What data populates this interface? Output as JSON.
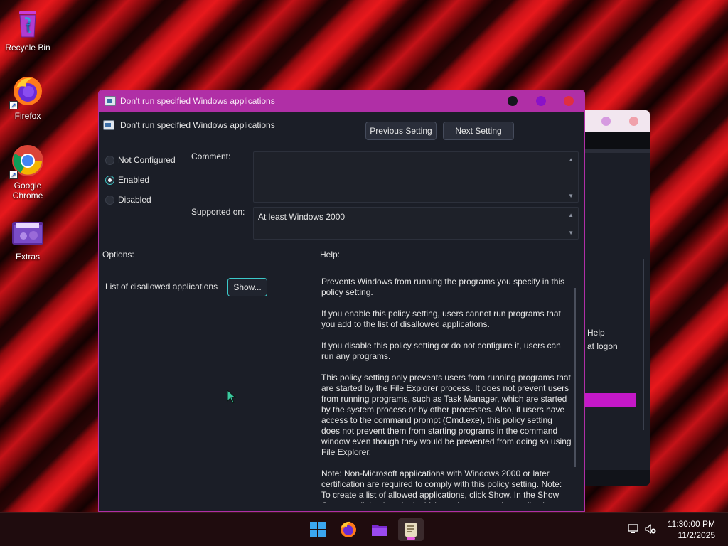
{
  "desktop": {
    "icons": [
      {
        "label": "Recycle Bin"
      },
      {
        "label": "Firefox"
      },
      {
        "label": "Google Chrome"
      },
      {
        "label": "Extras"
      }
    ]
  },
  "background_window": {
    "help_fragment": "Help",
    "logon_fragment": "at logon"
  },
  "dialog": {
    "title": "Don't run specified Windows applications",
    "setting_name": "Don't run specified Windows applications",
    "previous_button": "Previous Setting",
    "next_button": "Next Setting",
    "radio_not_configured": "Not Configured",
    "radio_enabled": "Enabled",
    "radio_disabled": "Disabled",
    "selected_option": "Enabled",
    "comment_label": "Comment:",
    "comment_value": "",
    "supported_label": "Supported on:",
    "supported_value": "At least Windows 2000",
    "options_label": "Options:",
    "help_label": "Help:",
    "list_label": "List of disallowed applications",
    "show_button": "Show...",
    "help_paragraphs": [
      "Prevents Windows from running the programs you specify in this policy setting.",
      "If you enable this policy setting, users cannot run programs that you add to the list of disallowed applications.",
      "If you disable this policy setting or do not configure it, users can run any programs.",
      "This policy setting only prevents users from running programs that are started by the File Explorer process. It does not prevent users from running programs, such as Task Manager, which are started by the system process or by other processes.  Also, if users have access to the command prompt (Cmd.exe), this policy setting does not prevent them from starting programs in the command window even though they would be prevented from doing so using File Explorer.",
      "Note: Non-Microsoft applications with Windows 2000 or later certification are required to comply with this policy setting. Note: To create a list of allowed applications, click Show.  In the Show Contents dialog box, in the Value column, type the application"
    ]
  },
  "taskbar": {
    "time": "11:30:00 PM",
    "date": "11/2/2025"
  },
  "colors": {
    "accent_titlebar": "#b02fa6",
    "dialog_bg": "#1b1e27",
    "focus_accent": "#3cc9c9"
  }
}
